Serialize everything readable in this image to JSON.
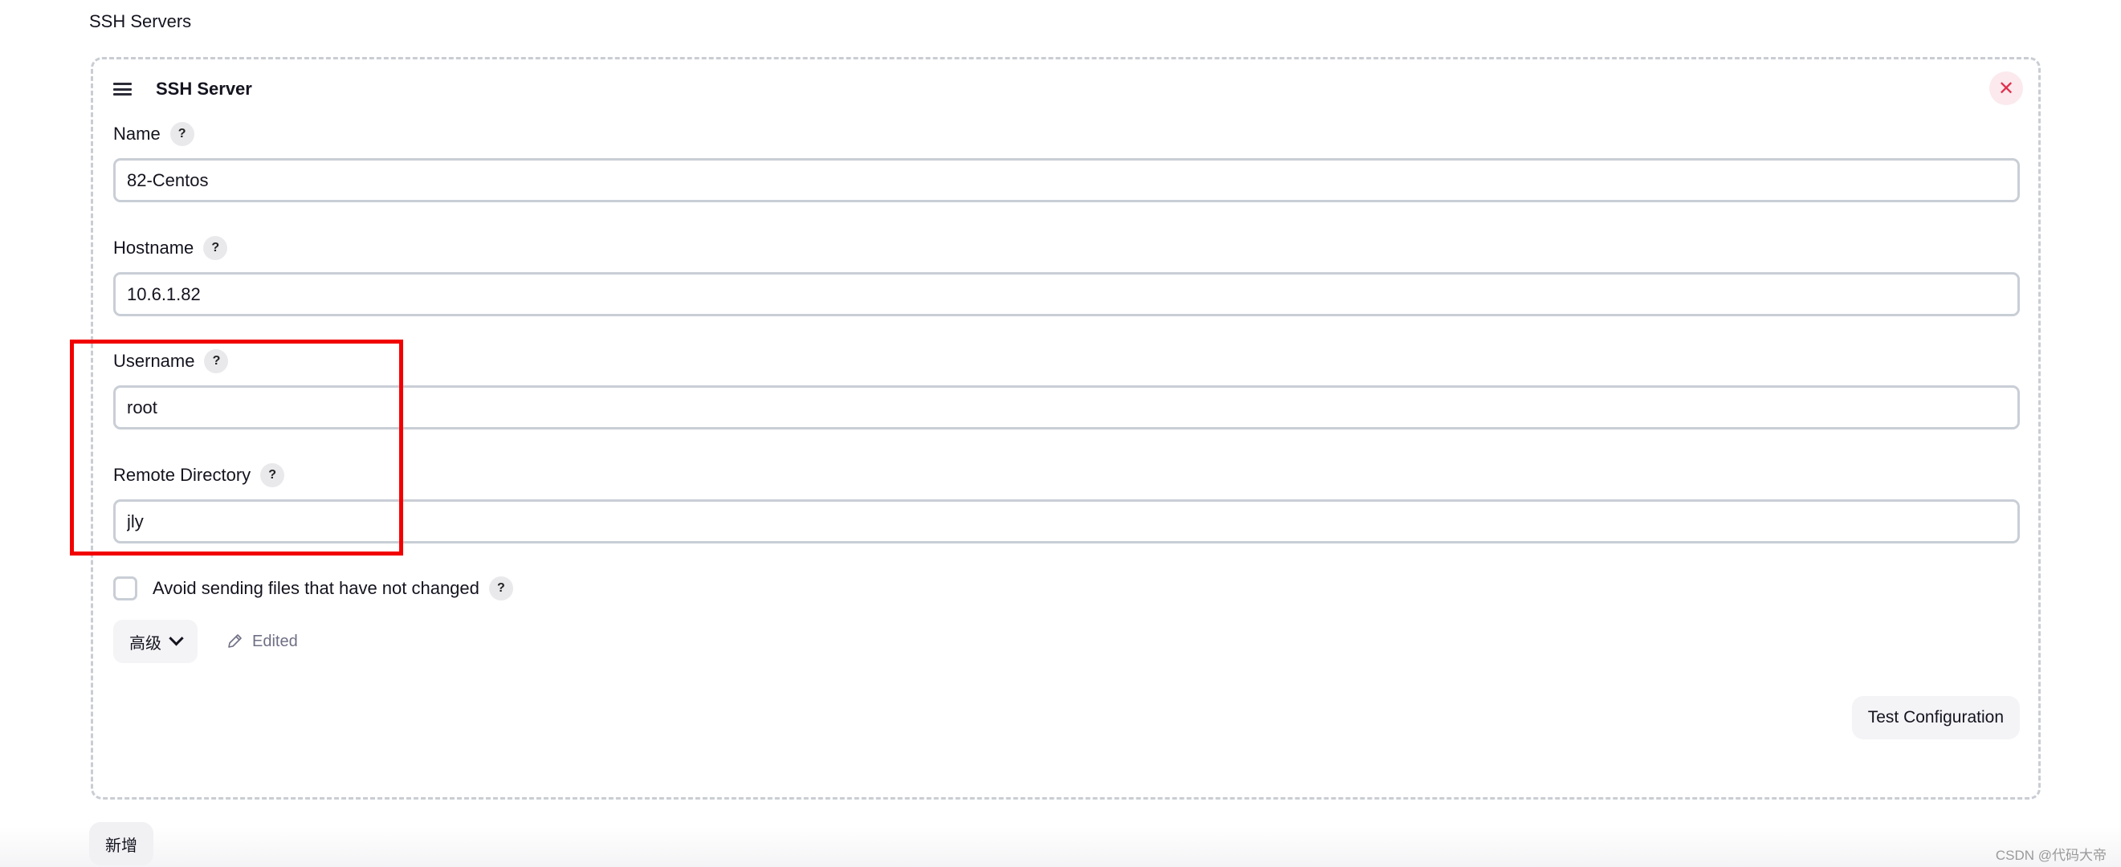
{
  "section": {
    "title": "SSH Servers"
  },
  "server": {
    "title": "SSH Server",
    "close_symbol": "✕",
    "fields": {
      "name": {
        "label": "Name",
        "value": "82-Centos",
        "help": "?"
      },
      "hostname": {
        "label": "Hostname",
        "value": "10.6.1.82",
        "help": "?"
      },
      "username": {
        "label": "Username",
        "value": "root",
        "help": "?"
      },
      "remote_directory": {
        "label": "Remote Directory",
        "value": "jly",
        "help": "?"
      }
    },
    "avoid_sending": {
      "label": "Avoid sending files that have not changed",
      "checked": false,
      "help": "?"
    },
    "advanced_label": "高级",
    "edited_label": "Edited",
    "test_configuration_label": "Test Configuration"
  },
  "add_button_label": "新增",
  "annotation": {
    "color": "#f20000"
  },
  "watermark": "CSDN @代码大帝"
}
